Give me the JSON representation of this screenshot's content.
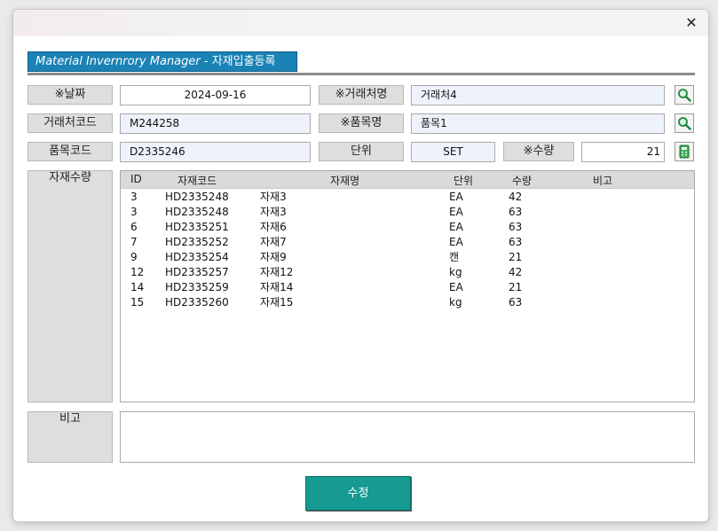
{
  "window": {
    "close_icon": "close-icon"
  },
  "header": {
    "title_en": "Material Invernrory Manager",
    "separator": " - ",
    "title_ko": "자재입출등록"
  },
  "form": {
    "date_label": "※날짜",
    "date_value": "2024-09-16",
    "vendor_name_label": "※거래처명",
    "vendor_name_value": "거래처4",
    "vendor_code_label": "거래처코드",
    "vendor_code_value": "M244258",
    "item_name_label": "※품목명",
    "item_name_value": "품목1",
    "item_code_label": "품목코드",
    "item_code_value": "D2335246",
    "unit_label": "단위",
    "unit_value": "SET",
    "qty_label": "※수량",
    "qty_value": "21",
    "material_qty_label": "자재수량",
    "remarks_label": "비고",
    "remarks_value": ""
  },
  "list": {
    "columns": [
      "ID",
      "자재코드",
      "자재명",
      "단위",
      "수량",
      "비고"
    ],
    "rows": [
      {
        "id": "3",
        "code": "HD2335248",
        "name": "자재3",
        "unit": "EA",
        "qty": "42",
        "note": ""
      },
      {
        "id": "3",
        "code": "HD2335248",
        "name": "자재3",
        "unit": "EA",
        "qty": "63",
        "note": ""
      },
      {
        "id": "6",
        "code": "HD2335251",
        "name": "자재6",
        "unit": "EA",
        "qty": "63",
        "note": ""
      },
      {
        "id": "7",
        "code": "HD2335252",
        "name": "자재7",
        "unit": "EA",
        "qty": "63",
        "note": ""
      },
      {
        "id": "9",
        "code": "HD2335254",
        "name": "자재9",
        "unit": "캔",
        "qty": "21",
        "note": ""
      },
      {
        "id": "12",
        "code": "HD2335257",
        "name": "자재12",
        "unit": "kg",
        "qty": "42",
        "note": ""
      },
      {
        "id": "14",
        "code": "HD2335259",
        "name": "자재14",
        "unit": "EA",
        "qty": "21",
        "note": ""
      },
      {
        "id": "15",
        "code": "HD2335260",
        "name": "자재15",
        "unit": "kg",
        "qty": "63",
        "note": ""
      }
    ]
  },
  "actions": {
    "edit_label": "수정"
  },
  "colors": {
    "accent_blue": "#1a82b5",
    "button_teal": "#169a91",
    "field_blue": "#eef3fb"
  },
  "icons": {
    "search": "search-icon",
    "calculator": "calculator-icon"
  }
}
